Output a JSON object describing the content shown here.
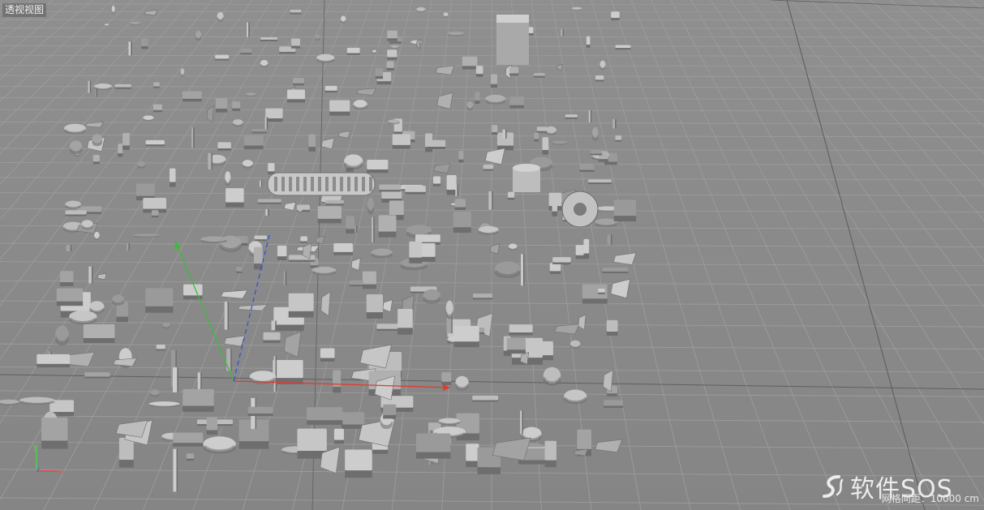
{
  "viewport": {
    "view_label": "透视视图",
    "grid_spacing": "网格间距：10000 cm",
    "axis_labels": {
      "x": "x",
      "y": "y"
    },
    "watermark": "软件SOS"
  },
  "colors": {
    "background": "#8a8a8a",
    "grid_line": "#9c9c9c",
    "grid_major": "#5f5f5f",
    "model_light": "#c4c4c4",
    "model_dark": "#6e6e6e",
    "axis_x": "#e23a2e",
    "axis_y": "#3dbb3a",
    "axis_z": "#2f4fd8"
  },
  "icons": [
    "axis-gizmo-icon",
    "watermark-logo-icon"
  ]
}
